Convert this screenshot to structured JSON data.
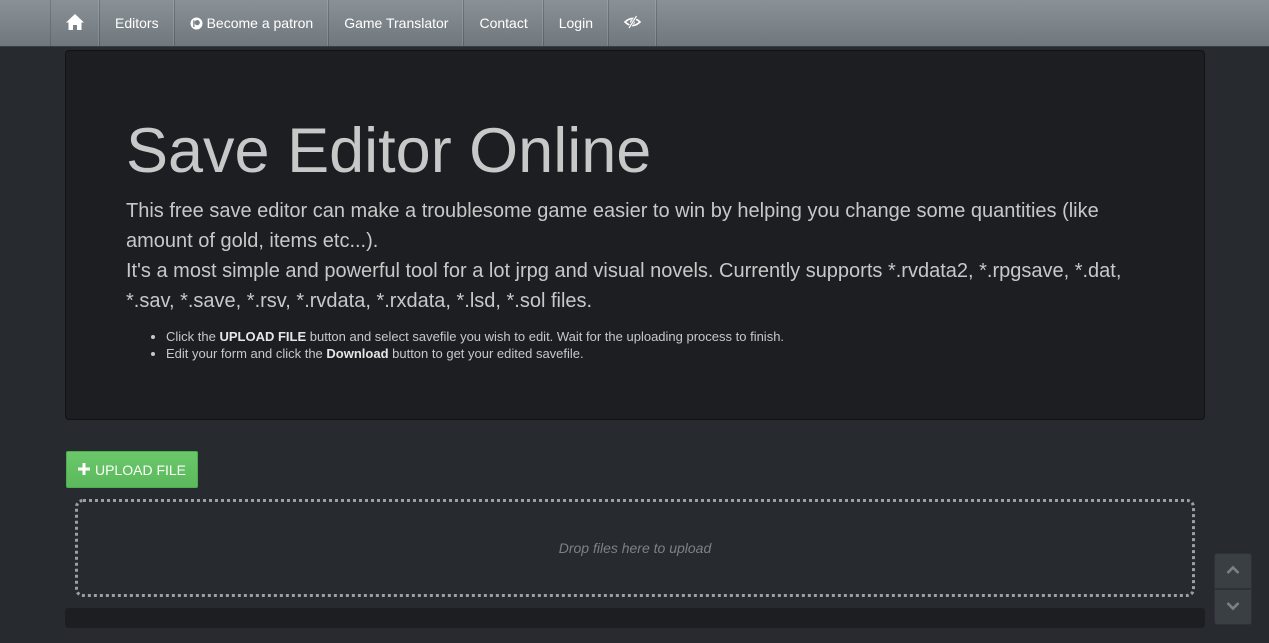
{
  "nav": {
    "home_icon": "home-icon",
    "items": [
      {
        "label": "Editors"
      },
      {
        "label": "Become a patron",
        "icon": "patreon-icon"
      },
      {
        "label": "Game Translator"
      },
      {
        "label": "Contact"
      },
      {
        "label": "Login"
      }
    ],
    "eye_icon": "eye-slash-icon"
  },
  "jumbotron": {
    "title": "Save Editor Online",
    "paragraph_1": "This free save editor can make a troublesome game easier to win by helping you change some quantities (like amount of gold, items etc...).",
    "paragraph_2": "It's a most simple and powerful tool for a lot jrpg and visual novels. Currently supports *.rvdata2, *.rpgsave, *.dat, *.sav, *.save, *.rsv, *.rvdata, *.rxdata, *.lsd, *.sol files.",
    "bullets": [
      {
        "before": "Click the ",
        "bold": "UPLOAD FILE",
        "after": " button and select savefile you wish to edit. Wait for the uploading process to finish."
      },
      {
        "before": "Edit your form and click the ",
        "bold": "Download",
        "after": " button to get your edited savefile."
      }
    ]
  },
  "upload_button": {
    "label": "UPLOAD FILE",
    "icon": "plus-icon"
  },
  "dropzone": {
    "text": "Drop files here to upload"
  },
  "scroll": {
    "up_icon": "chevron-up-icon",
    "down_icon": "chevron-down-icon"
  },
  "colors": {
    "background": "#272b30",
    "navbar": "#7a8288",
    "jumbotron": "#1c1e22",
    "success": "#5cb85c"
  }
}
